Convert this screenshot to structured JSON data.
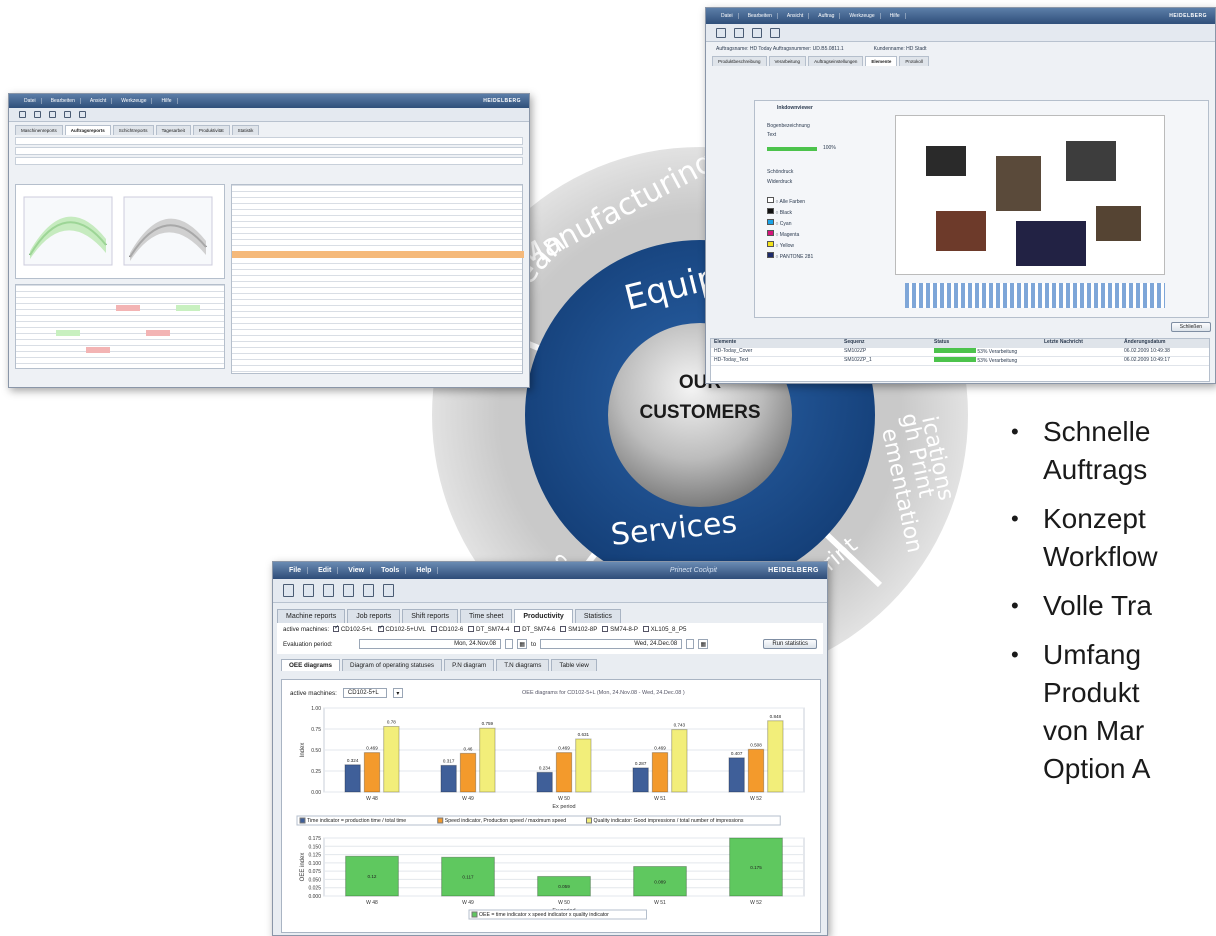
{
  "ring": {
    "segments": [
      "Lean Manufacturing",
      "Implementation through Print Applications",
      "Web-to-Print"
    ],
    "inner_labels": [
      "Equip",
      "Services"
    ],
    "center": [
      "OUR",
      "CUSTOMERS"
    ],
    "colors": {
      "outer": "#cfcfcf",
      "inner": "#1e4e8c",
      "center": "#bdbdbd"
    }
  },
  "left_window": {
    "menu": [
      "Datei",
      "Bearbeiten",
      "Ansicht",
      "Werkzeuge",
      "Hilfe"
    ],
    "brand": "HEIDELBERG",
    "tabs": [
      "Maschinenreports",
      "Auftragsreports",
      "Schichtreports",
      "Tagesarbeit",
      "Produktivität",
      "Statistik"
    ]
  },
  "right_window": {
    "menu": [
      "Datei",
      "Bearbeiten",
      "Ansicht",
      "Auftrag",
      "Werkzeuge",
      "Hilfe"
    ],
    "brand": "HEIDELBERG",
    "info": "Auftragsname: HD Today  Auftragsnummer: UD.B5.0811.1",
    "customer": "Kundenname: HD Stadt",
    "tabs": [
      "Produktbeschreibung",
      "Verarbeitung",
      "Auftragseinstellungen",
      "Elemente",
      "Protokoll"
    ],
    "viewer_title": "Inkdownviewer",
    "sheet_label": "Bogenbezeichnung",
    "sheet_value": "Text",
    "percent": "100%",
    "sides": [
      "Schöndruck",
      "Widerdruck"
    ],
    "colors": [
      {
        "name": "Alle Farben",
        "hex": "#ffffff"
      },
      {
        "name": "Black",
        "hex": "#111111"
      },
      {
        "name": "Cyan",
        "hex": "#1aa3e8"
      },
      {
        "name": "Magenta",
        "hex": "#d4137a"
      },
      {
        "name": "Yellow",
        "hex": "#f2e21b"
      },
      {
        "name": "PANTONE 281",
        "hex": "#1d2b6b"
      }
    ],
    "table_headers": [
      "Elemente",
      "Sequenz",
      "Status",
      "Letzte Nachricht",
      "Änderungsdatum"
    ],
    "rows": [
      [
        "HD-Today_Cover",
        "SM102ZP",
        "53% Verarbeitung",
        "",
        "06.02.2009 10:49:38"
      ],
      [
        "HD-Today_Text",
        "SM102ZP_1",
        "53% Verarbeitung",
        "",
        "06.02.2009 10:49:17"
      ]
    ],
    "button": "Schließen"
  },
  "main_window": {
    "menu": [
      "File",
      "Edit",
      "View",
      "Tools",
      "Help"
    ],
    "project": "Prinect Cockpit",
    "brand": "HEIDELBERG",
    "tabs": [
      "Machine reports",
      "Job reports",
      "Shift reports",
      "Time sheet",
      "Productivity",
      "Statistics"
    ],
    "active_label": "active machines:",
    "machines": [
      {
        "name": "CD102-5+L",
        "checked": true
      },
      {
        "name": "CD102-5+UVL",
        "checked": true
      },
      {
        "name": "CD102-6",
        "checked": false
      },
      {
        "name": "DT_SM74-4",
        "checked": false
      },
      {
        "name": "DT_SM74-6",
        "checked": false
      },
      {
        "name": "SM102-8P",
        "checked": false
      },
      {
        "name": "SM74-8-P",
        "checked": false
      },
      {
        "name": "XL105_8_P5",
        "checked": false
      }
    ],
    "eval_label": "Evaluation period:",
    "date_from": "Mon, 24.Nov.08",
    "to_label": "to",
    "date_to": "Wed, 24.Dec.08",
    "run_button": "Run statistics",
    "subtabs": [
      "OEE diagrams",
      "Diagram of operating statuses",
      "P.N diagram",
      "T.N diagrams",
      "Table view"
    ],
    "machine_select": "CD102-5+L",
    "chart_title": "OEE diagrams for CD102-5+L  (Mon, 24.Nov.08 - Wed, 24.Dec.08 )"
  },
  "chart_data": [
    {
      "type": "bar",
      "categories": [
        "W 48",
        "W 49",
        "W 50",
        "W 51",
        "W 52"
      ],
      "series": [
        {
          "name": "Time indicator = production time / total time",
          "color": "#3f5f99",
          "values": [
            0.324,
            0.317,
            0.234,
            0.287,
            0.407
          ]
        },
        {
          "name": "Speed indicator, Production speed / maximum speed",
          "color": "#f39a2c",
          "values": [
            0.469,
            0.46,
            0.469,
            0.469,
            0.508
          ]
        },
        {
          "name": "Quality indicator: Good impressions / total number of impressions",
          "color": "#f2ee7a",
          "values": [
            0.78,
            0.759,
            0.631,
            0.743,
            0.848
          ]
        }
      ],
      "value_labels": [
        [
          "0.324",
          "0.469",
          "0.78"
        ],
        [
          "0.317",
          "0.46",
          "0.759"
        ],
        [
          "0.234",
          "0.469",
          "0.631"
        ],
        [
          "0.287",
          "0.469",
          "0.743"
        ],
        [
          "0.407",
          "0.508",
          "0.848"
        ]
      ],
      "ylabel": "Index",
      "xlabel": "Ex period",
      "ylim": [
        0,
        1
      ],
      "yticks": [
        "1.00",
        "0.75",
        "0.50",
        "0.25",
        "0.00"
      ]
    },
    {
      "type": "bar",
      "categories": [
        "W 48",
        "W 49",
        "W 50",
        "W 51",
        "W 52"
      ],
      "series": [
        {
          "name": "OEE = time indicator x speed indicator x quality indicator",
          "color": "#5fc85f",
          "values": [
            0.12,
            0.117,
            0.059,
            0.089,
            0.175
          ]
        }
      ],
      "value_labels": [
        "0.12",
        "0.117",
        "0.059",
        "0.089",
        "0.175"
      ],
      "ylabel": "OEE index",
      "xlabel": "Ex period",
      "ylim": [
        0,
        0.175
      ],
      "yticks": [
        "0.175",
        "0.150",
        "0.125",
        "0.100",
        "0.075",
        "0.050",
        "0.025",
        "0.000"
      ]
    }
  ],
  "bullets": [
    [
      "Schnelle",
      "Auftrags"
    ],
    [
      "Konzept",
      "Workflow"
    ],
    [
      "Volle Tra"
    ],
    [
      "Umfang",
      "Produkt",
      "von Mar",
      "Option A"
    ]
  ]
}
